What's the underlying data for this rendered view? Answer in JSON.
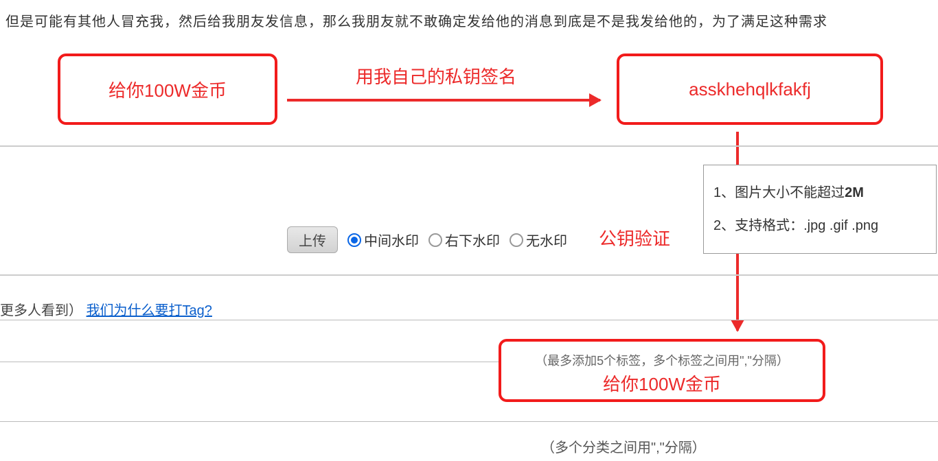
{
  "paragraph": "但是可能有其他人冒充我，然后给我朋友发信息，那么我朋友就不敢确定发给他的消息到底是不是我发给他的，为了满足这种需求",
  "diagram": {
    "leftBox": "给你100W金币",
    "rightBox": "asskhehqlkfakfj",
    "bottomBoxSmall": "（最多添加5个标签，多个标签之间用\",\"分隔）",
    "bottomBoxMain": "给你100W金币",
    "topArrowLabel": "用我自己的私钥签名",
    "rightArrowLabel": "公钥验证"
  },
  "upload": {
    "buttonLabel": "上传",
    "optionCenter": "中间水印",
    "optionBottomRight": "右下水印",
    "optionNone": "无水印"
  },
  "infoBox": {
    "line1Prefix": "1、图片大小不能超过",
    "line1Bold": "2M",
    "line2": "2、支持格式：.jpg .gif .png"
  },
  "tagRow": {
    "prefix": "更多人看到）",
    "link": "我们为什么要打Tag?"
  },
  "categoryHint": "（多个分类之间用\",\"分隔）"
}
